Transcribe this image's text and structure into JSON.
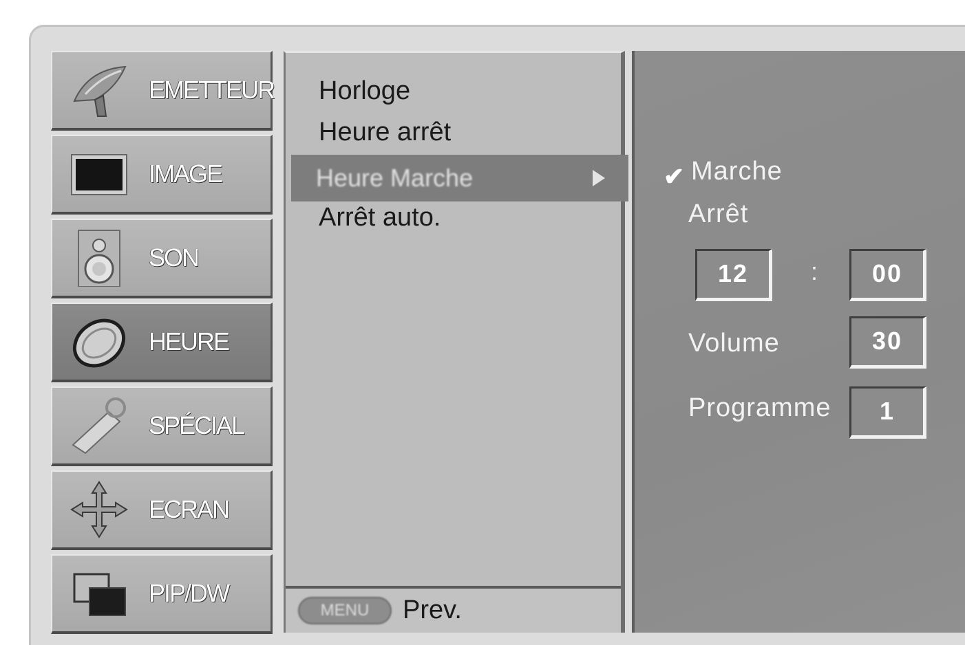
{
  "main_menu": {
    "items": [
      {
        "label": "EMETTEUR",
        "icon": "satellite-dish-icon"
      },
      {
        "label": "IMAGE",
        "icon": "picture-screen-icon"
      },
      {
        "label": "SON",
        "icon": "speaker-icon"
      },
      {
        "label": "HEURE",
        "icon": "clock-icon"
      },
      {
        "label": "SPÉCIAL",
        "icon": "special-tool-icon"
      },
      {
        "label": "ECRAN",
        "icon": "move-arrows-icon"
      },
      {
        "label": "PIP/DW",
        "icon": "pip-windows-icon"
      }
    ],
    "active": "HEURE"
  },
  "submenu": {
    "items": [
      "Horloge",
      "Heure arrêt",
      "Heure Marche",
      "Arrêt auto."
    ],
    "selected": "Heure Marche",
    "footer": {
      "key_label": "MENU",
      "action_label": "Prev."
    }
  },
  "options": {
    "on_label": "Marche",
    "off_label": "Arrêt",
    "checked": "Marche",
    "hour": "12",
    "separator": ":",
    "minute": "00",
    "volume_label": "Volume",
    "volume_value": "30",
    "programme_label": "Programme",
    "programme_value": "1"
  }
}
